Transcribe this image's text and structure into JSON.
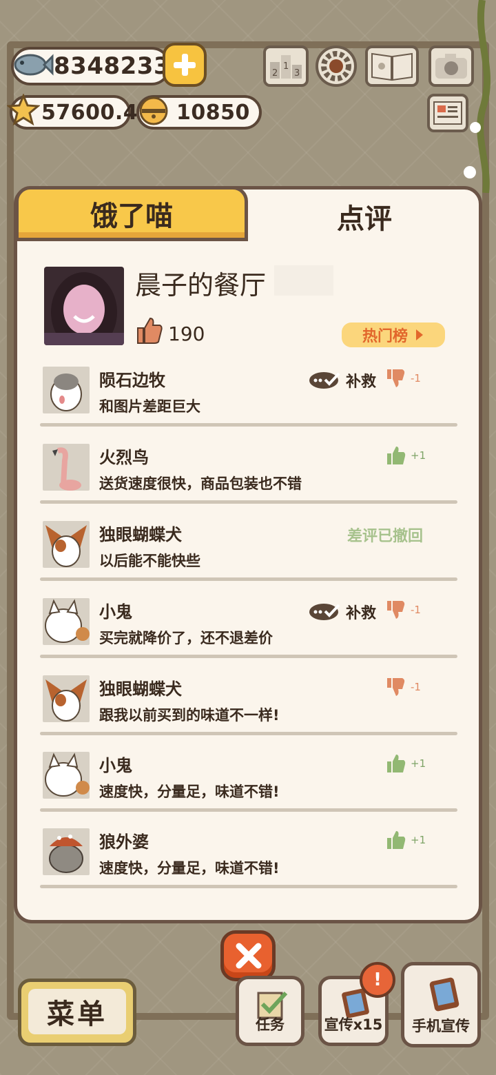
{
  "currency": {
    "fish": "8348233",
    "stars": "57600.4",
    "bells": "10850"
  },
  "top_icons": [
    "ranking-icon",
    "settings-gear-icon",
    "recipe-book-icon",
    "camera-icon",
    "newspaper-icon"
  ],
  "tabs": {
    "left": "饿了喵",
    "right": "点评"
  },
  "profile": {
    "restaurant_name": "晨子的餐厅",
    "likes": "190",
    "hot_list_label": "热门榜"
  },
  "reviews": [
    {
      "name": "陨石边牧",
      "text": "和图片差距巨大",
      "rating": "negative",
      "delta": "-1",
      "remedy_label": "补救"
    },
    {
      "name": "火烈鸟",
      "text": "送货速度很快，商品包装也不错",
      "rating": "positive",
      "delta": "+1"
    },
    {
      "name": "独眼蝴蝶犬",
      "text": "以后能不能快些",
      "status": "差评已撤回"
    },
    {
      "name": "小鬼",
      "text": "买完就降价了，还不退差价",
      "rating": "negative",
      "delta": "-1",
      "remedy_label": "补救"
    },
    {
      "name": "独眼蝴蝶犬",
      "text": "跟我以前买到的味道不一样!",
      "rating": "negative",
      "delta": "-1"
    },
    {
      "name": "小鬼",
      "text": "速度快，分量足，味道不错!",
      "rating": "positive",
      "delta": "+1"
    },
    {
      "name": "狼外婆",
      "text": "速度快，分量足，味道不错!",
      "rating": "positive",
      "delta": "+1"
    }
  ],
  "bottom": {
    "menu_label": "菜单",
    "tasks_label": "任务",
    "promo_label": "宣传x15",
    "phone_promo_label": "手机宣传",
    "alert_mark": "!"
  },
  "colors": {
    "accent_yellow": "#f8c84a",
    "close_orange": "#e8612f",
    "negative": "#e08a63",
    "positive": "#7ea467"
  }
}
